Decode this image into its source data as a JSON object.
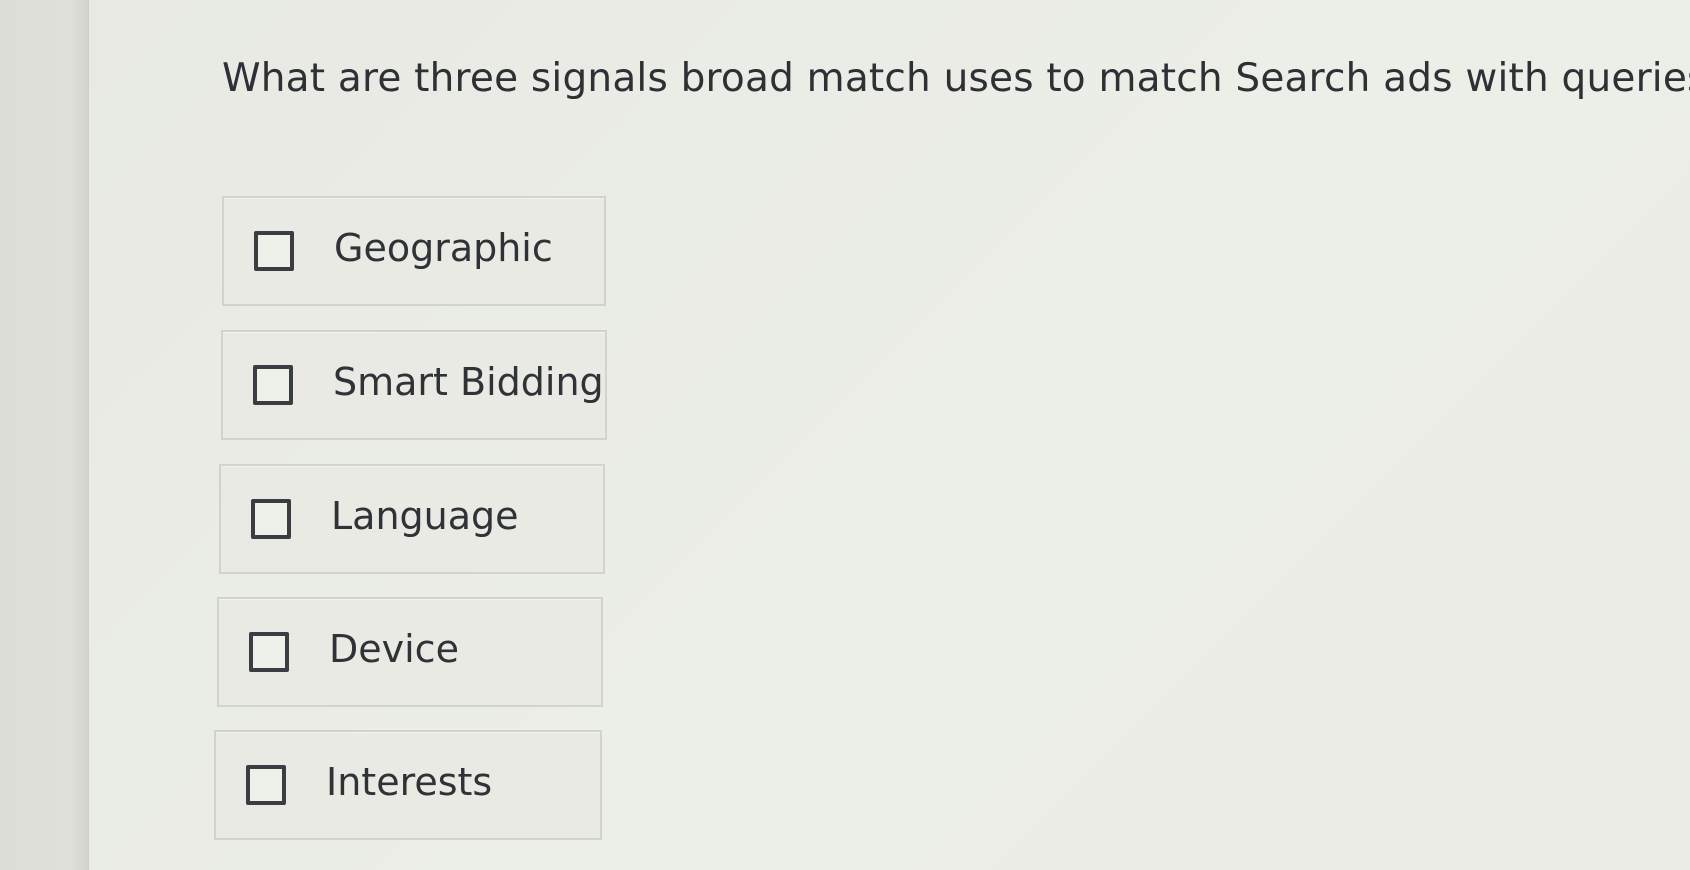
{
  "question": {
    "text": "What are three signals broad match uses to match Search ads with queries?"
  },
  "options": [
    {
      "label": "Geographic",
      "checked": false
    },
    {
      "label": "Smart Bidding",
      "checked": false
    },
    {
      "label": "Language",
      "checked": false
    },
    {
      "label": "Device",
      "checked": false
    },
    {
      "label": "Interests",
      "checked": false
    }
  ],
  "colors": {
    "background": "#e8e9e3",
    "text": "#2d3034",
    "option_border": "#d2d3cc",
    "checkbox_border": "#3a3d41"
  }
}
